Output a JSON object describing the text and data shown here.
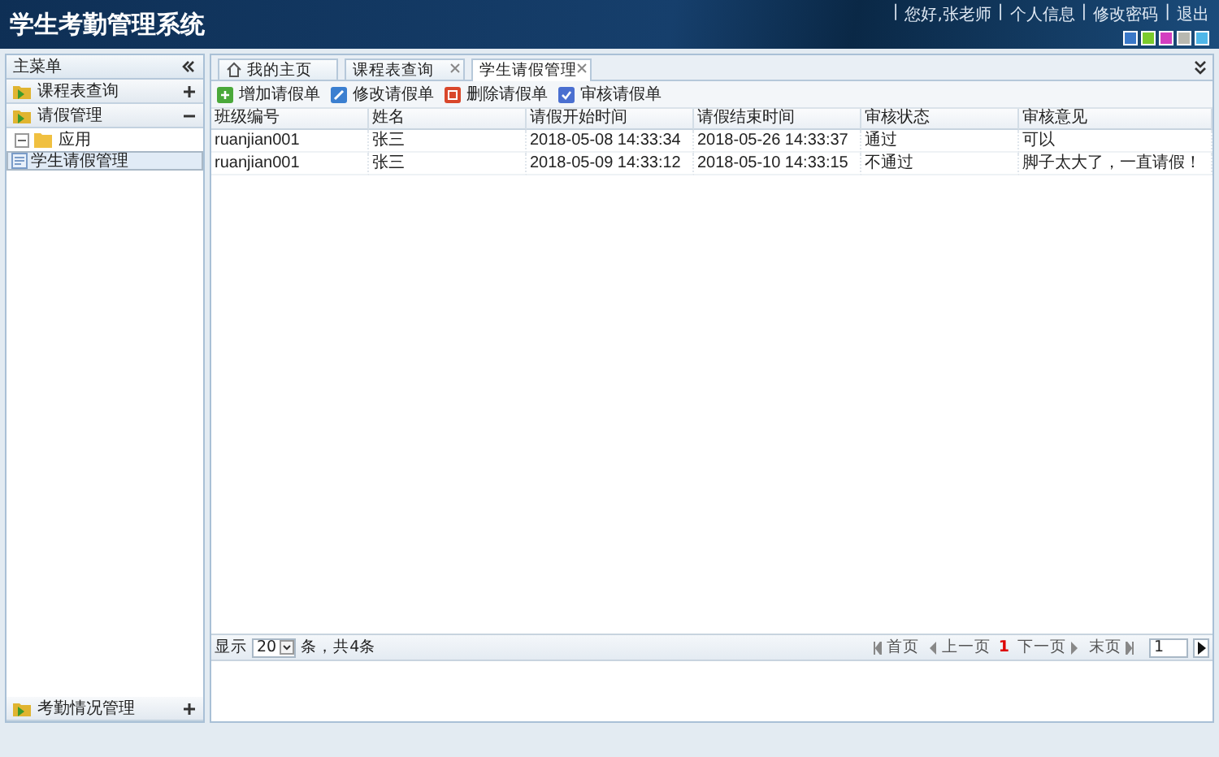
{
  "header": {
    "title": "学生考勤管理系统",
    "separator": "|",
    "links": [
      "您好,张老师",
      "个人信息",
      "修改密码",
      "退出"
    ],
    "themes": [
      {
        "color": "#3a78c8"
      },
      {
        "color": "#7ccb2c"
      },
      {
        "color": "#d33fc0"
      },
      {
        "color": "#b8b8b0"
      },
      {
        "color": "#4fb6e8"
      }
    ]
  },
  "sidebar": {
    "title": "主菜单",
    "groups": [
      {
        "label": "课程表查询",
        "expanded": false
      },
      {
        "label": "请假管理",
        "expanded": true,
        "children": [
          {
            "label": "应用",
            "expanded": true,
            "selected": false,
            "children": [
              {
                "label": "学生请假管理",
                "selected": true
              }
            ]
          }
        ]
      }
    ],
    "bottom_group": {
      "label": "考勤情况管理",
      "expanded": false
    }
  },
  "tabs": [
    {
      "label": "我的主页",
      "kind": "home",
      "closable": false,
      "selected": false
    },
    {
      "label": "课程表查询",
      "kind": "page",
      "closable": true,
      "selected": false
    },
    {
      "label": "学生请假管理",
      "kind": "page",
      "closable": true,
      "selected": true
    }
  ],
  "toolbar": [
    {
      "label": "增加请假单",
      "kind": "add"
    },
    {
      "label": "修改请假单",
      "kind": "edit"
    },
    {
      "label": "删除请假单",
      "kind": "delete"
    },
    {
      "label": "审核请假单",
      "kind": "audit"
    }
  ],
  "table": {
    "columns": [
      "班级编号",
      "姓名",
      "请假开始时间",
      "请假结束时间",
      "审核状态",
      "审核意见"
    ],
    "rows": [
      [
        "ruanjian001",
        "张三",
        "2018-05-08 14:33:34",
        "2018-05-26 14:33:37",
        "通过",
        "可以"
      ],
      [
        "ruanjian001",
        "张三",
        "2018-05-09 14:33:12",
        "2018-05-10 14:33:15",
        "不通过",
        "脚子太大了，一直请假！"
      ]
    ]
  },
  "pager": {
    "show_label": "显示",
    "page_size": "20",
    "count_text": "条，共4条",
    "first": "首页",
    "prev": "上一页",
    "current": "1",
    "next": "下一页",
    "last": "末页",
    "page_input": "1"
  }
}
